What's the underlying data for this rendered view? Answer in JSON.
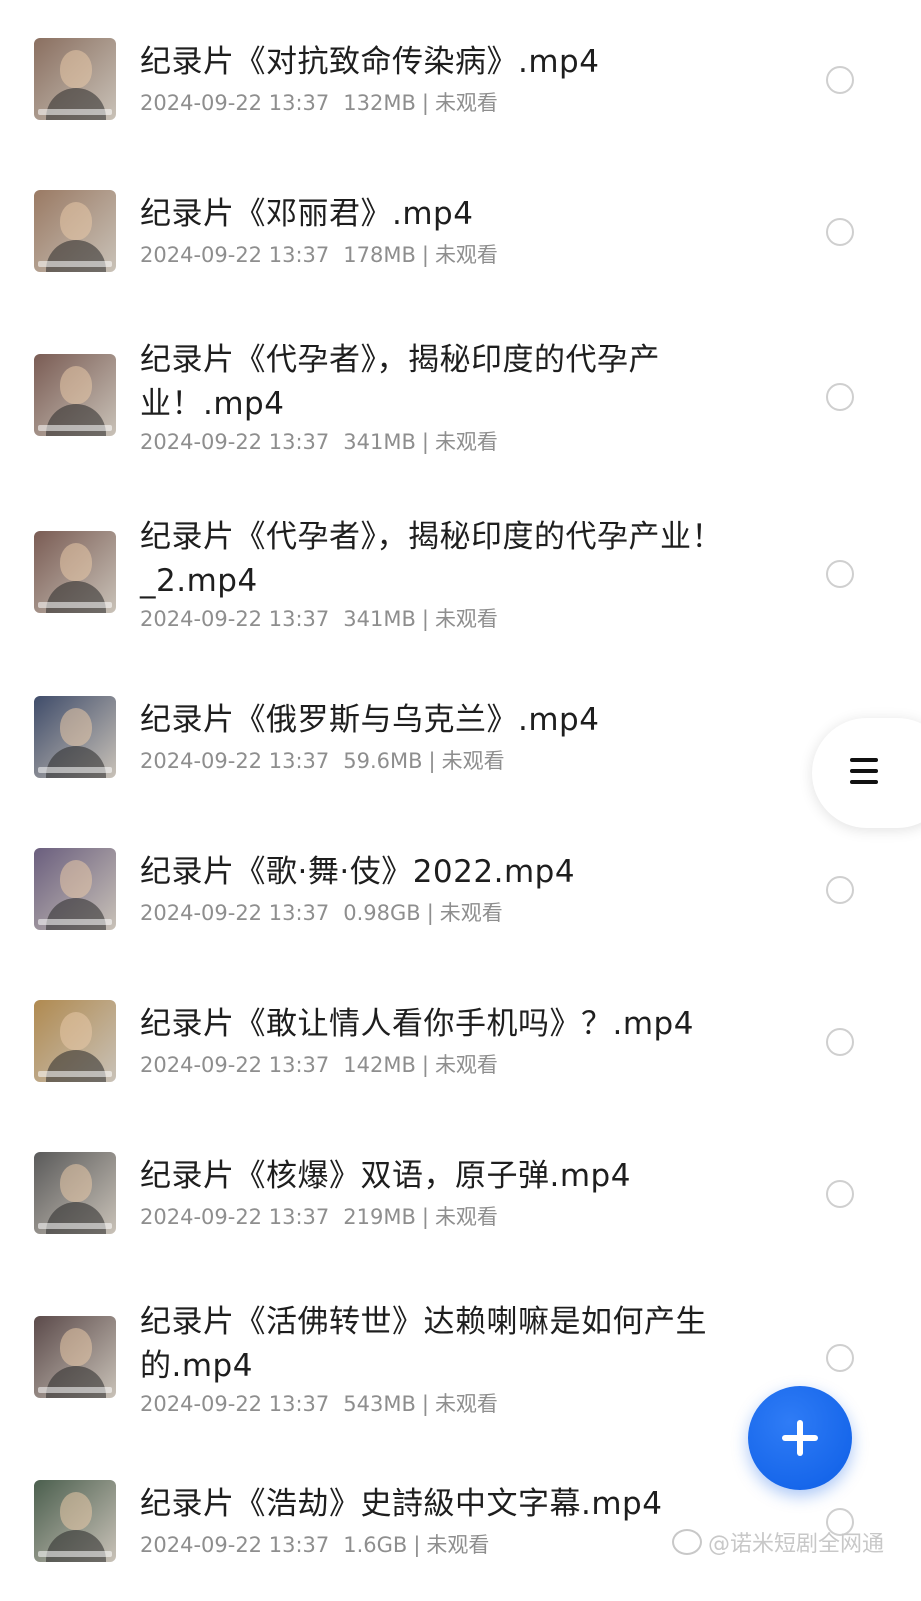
{
  "files": [
    {
      "title": "纪录片《对抗致命传染病》.mp4",
      "date": "2024-09-22 13:37",
      "size": "132MB",
      "status": "未观看",
      "thumb": "#8a6f60"
    },
    {
      "title": "纪录片《邓丽君》.mp4",
      "date": "2024-09-22 13:37",
      "size": "178MB",
      "status": "未观看",
      "thumb": "#9a7a64"
    },
    {
      "title": "纪录片《代孕者》，揭秘印度的代孕产业！.mp4",
      "date": "2024-09-22 13:37",
      "size": "341MB",
      "status": "未观看",
      "thumb": "#7a5c54"
    },
    {
      "title": "纪录片《代孕者》，揭秘印度的代孕产业！_2.mp4",
      "date": "2024-09-22 13:37",
      "size": "341MB",
      "status": "未观看",
      "thumb": "#7a5c54"
    },
    {
      "title": "纪录片《俄罗斯与乌克兰》.mp4",
      "date": "2024-09-22 13:37",
      "size": "59.6MB",
      "status": "未观看",
      "thumb": "#3f4c6a"
    },
    {
      "title": "纪录片《歌·舞·伎》2022.mp4",
      "date": "2024-09-22 13:37",
      "size": "0.98GB",
      "status": "未观看",
      "thumb": "#6a5e7e"
    },
    {
      "title": "纪录片《敢让情人看你手机吗》？.mp4",
      "date": "2024-09-22 13:37",
      "size": "142MB",
      "status": "未观看",
      "thumb": "#b08a50"
    },
    {
      "title": "纪录片《核爆》双语，原子弹.mp4",
      "date": "2024-09-22 13:37",
      "size": "219MB",
      "status": "未观看",
      "thumb": "#5a5a5a"
    },
    {
      "title": "纪录片《活佛转世》达赖喇嘛是如何产生的.mp4",
      "date": "2024-09-22 13:37",
      "size": "543MB",
      "status": "未观看",
      "thumb": "#5b4a4a"
    },
    {
      "title": "纪录片《浩劫》史詩級中文字幕.mp4",
      "date": "2024-09-22 13:37",
      "size": "1.6GB",
      "status": "未观看",
      "thumb": "#4b5f4e"
    }
  ],
  "watermark": "@诺米短剧全网通",
  "icons": {
    "menu": "hamburger-menu-icon",
    "add": "plus-icon",
    "select": "radio-circle-icon"
  },
  "colors": {
    "accent": "#1565ee",
    "meta_text": "#8e8e8e"
  }
}
